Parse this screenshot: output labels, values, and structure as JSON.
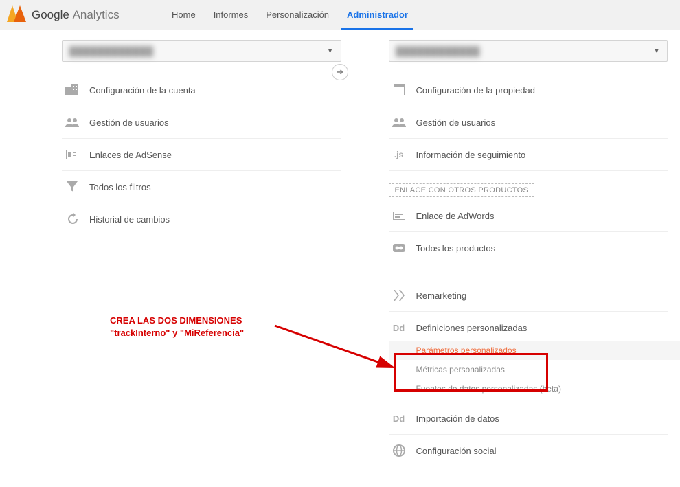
{
  "header": {
    "brand_bold": "Google",
    "brand_thin": "Analytics",
    "tabs": [
      "Home",
      "Informes",
      "Personalización",
      "Administrador"
    ],
    "active_tab_index": 3
  },
  "left_column": {
    "dropdown_value": "████████████",
    "items": [
      {
        "icon": "building-icon",
        "label": "Configuración de la cuenta"
      },
      {
        "icon": "users-icon",
        "label": "Gestión de usuarios"
      },
      {
        "icon": "adsense-icon",
        "label": "Enlaces de AdSense"
      },
      {
        "icon": "funnel-icon",
        "label": "Todos los filtros"
      },
      {
        "icon": "history-icon",
        "label": "Historial de cambios"
      }
    ]
  },
  "right_column": {
    "dropdown_value": "████████████",
    "items_top": [
      {
        "icon": "page-icon",
        "label": "Configuración de la propiedad"
      },
      {
        "icon": "users-icon",
        "label": "Gestión de usuarios"
      },
      {
        "icon": "js-icon",
        "label": "Información de seguimiento"
      }
    ],
    "section_header": "ENLACE CON OTROS PRODUCTOS",
    "items_mid": [
      {
        "icon": "card-icon",
        "label": "Enlace de AdWords"
      },
      {
        "icon": "link-icon",
        "label": "Todos los productos"
      }
    ],
    "items_bottom": [
      {
        "icon": "remarketing-icon",
        "label": "Remarketing"
      },
      {
        "icon": "dd-icon",
        "label": "Definiciones personalizadas"
      }
    ],
    "sub_items": [
      {
        "label": "Parámetros personalizados",
        "active": true
      },
      {
        "label": "Métricas personalizadas",
        "active": false
      },
      {
        "label": "Fuentes de datos personalizadas (beta)",
        "active": false
      }
    ],
    "items_tail": [
      {
        "icon": "dd-icon",
        "label": "Importación de datos"
      },
      {
        "icon": "globe-icon",
        "label": "Configuración social"
      }
    ]
  },
  "annotation": {
    "line1": "CREA LAS DOS DIMENSIONES",
    "line2": "\"trackInterno\" y \"MiReferencia\""
  }
}
